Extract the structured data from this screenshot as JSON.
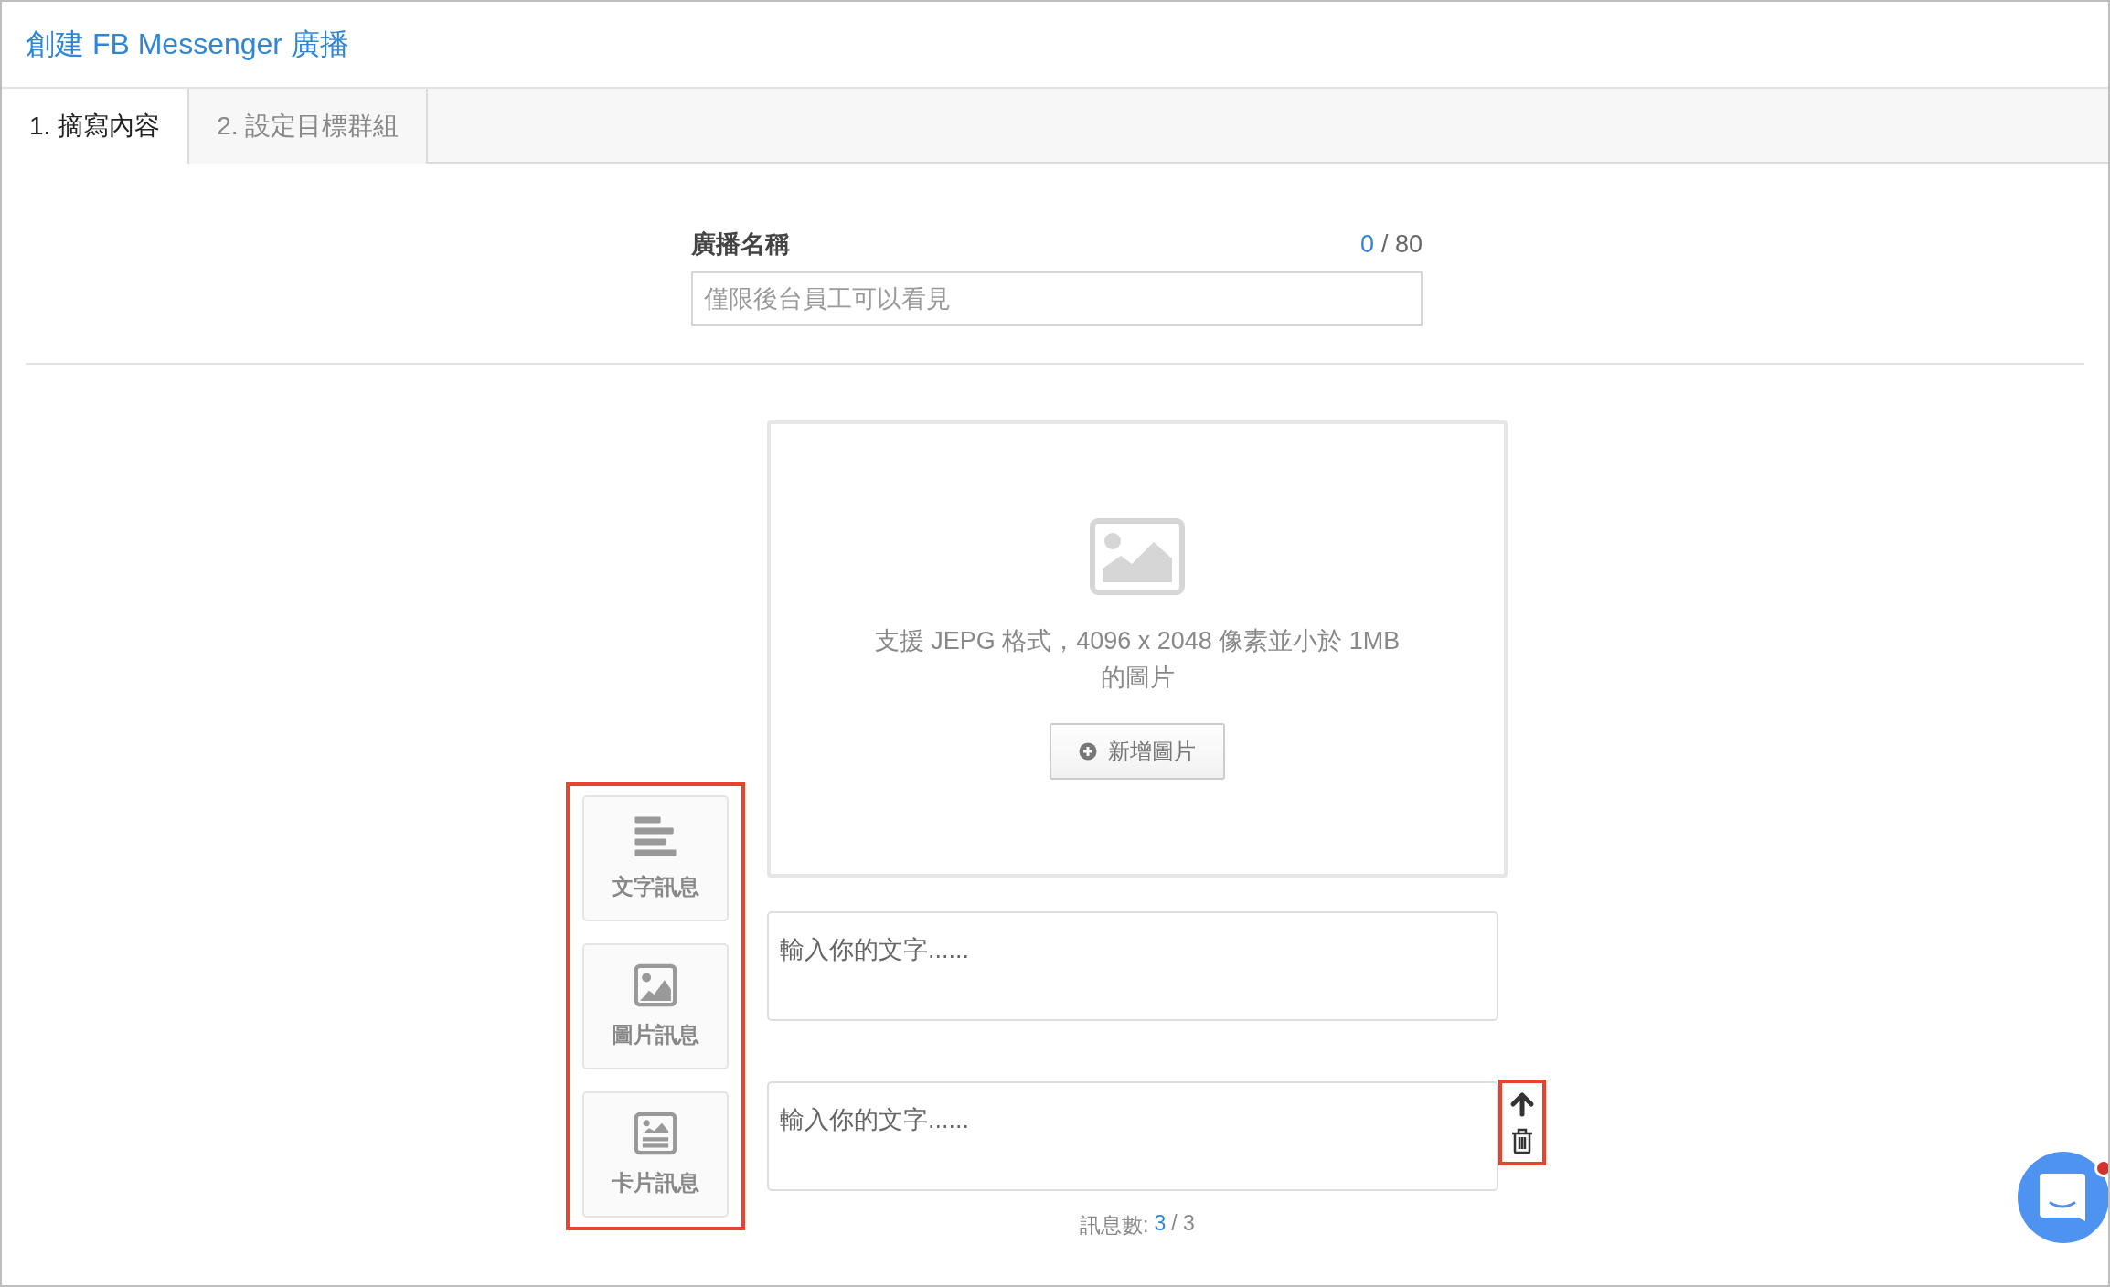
{
  "header": {
    "title": "創建 FB Messenger 廣播"
  },
  "tabs": [
    {
      "label": "1. 摘寫內容",
      "selected": true
    },
    {
      "label": "2. 設定目標群組",
      "selected": false
    }
  ],
  "name_field": {
    "label": "廣播名稱",
    "count": "0",
    "limit": "/ 80",
    "placeholder": "僅限後台員工可以看見"
  },
  "palette": [
    {
      "kind": "text",
      "label": "文字訊息"
    },
    {
      "kind": "image",
      "label": "圖片訊息"
    },
    {
      "kind": "card",
      "label": "卡片訊息"
    }
  ],
  "messages": [
    {
      "kind": "image",
      "hint": "支援 JEPG 格式，4096 x 2048 像素並小於 1MB 的圖片",
      "button": "新增圖片"
    },
    {
      "kind": "text",
      "placeholder": "輸入你的文字......",
      "tools": false
    },
    {
      "kind": "text",
      "placeholder": "輸入你的文字......",
      "tools": true
    }
  ],
  "message_count": {
    "label": "訊息數:",
    "current": "3",
    "total": "/ 3"
  },
  "chat_widget": {
    "unread": true
  }
}
